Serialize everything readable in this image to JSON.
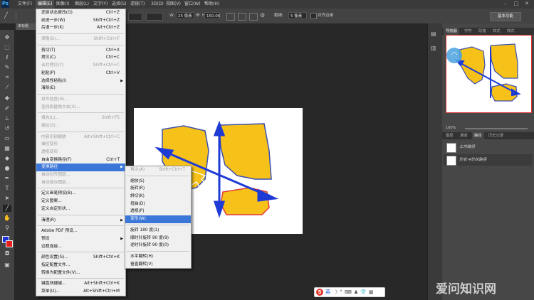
{
  "app": {
    "logo": "Ps"
  },
  "menubar": {
    "items": [
      "文件(F)",
      "编辑(E)",
      "图像(I)",
      "图层(L)",
      "文字(Y)",
      "选择(S)",
      "滤镜(T)",
      "3D(D)",
      "视图(V)",
      "窗口(W)",
      "帮助(H)"
    ],
    "active": "编辑(E)"
  },
  "options": {
    "w_label": "W:",
    "w_value": "25 像素",
    "h_value": "150.06",
    "radius_label": "粗细:",
    "radius_value": "5 像素",
    "align_label": "对齐边缘",
    "workspace": "基本功能"
  },
  "document": {
    "tab_title": "未标题"
  },
  "edit_menu": {
    "items": [
      {
        "label": "还原状态更改(O)",
        "shortcut": "Ctrl+Z"
      },
      {
        "label": "前进一步(W)",
        "shortcut": "Shift+Ctrl+Z"
      },
      {
        "label": "后退一步(K)",
        "shortcut": "Alt+Ctrl+Z"
      },
      {
        "sep": true
      },
      {
        "label": "渐隐(D)...",
        "shortcut": "Shift+Ctrl+F",
        "disabled": true
      },
      {
        "sep": true
      },
      {
        "label": "剪切(T)",
        "shortcut": "Ctrl+X"
      },
      {
        "label": "拷贝(C)",
        "shortcut": "Ctrl+C"
      },
      {
        "label": "合并拷贝(Y)",
        "shortcut": "Shift+Ctrl+C",
        "disabled": true
      },
      {
        "label": "粘贴(P)",
        "shortcut": "Ctrl+V"
      },
      {
        "label": "选择性粘贴(I)",
        "submenu": true
      },
      {
        "label": "清除(E)"
      },
      {
        "sep": true
      },
      {
        "label": "拼写检查(H)...",
        "disabled": true
      },
      {
        "label": "查找和替换文本(X)...",
        "disabled": true
      },
      {
        "sep": true
      },
      {
        "label": "填充(L)...",
        "shortcut": "Shift+F5",
        "disabled": true
      },
      {
        "label": "描边(S)...",
        "disabled": true
      },
      {
        "sep": true
      },
      {
        "label": "内容识别缩放",
        "shortcut": "Alt+Shift+Ctrl+C",
        "disabled": true
      },
      {
        "label": "操控变形",
        "disabled": true
      },
      {
        "label": "透视变形",
        "disabled": true
      },
      {
        "label": "自由变换路径(F)",
        "shortcut": "Ctrl+T"
      },
      {
        "label": "变换路径",
        "submenu": true,
        "highlight": true
      },
      {
        "label": "自动对齐图层...",
        "disabled": true
      },
      {
        "label": "自动混合图层...",
        "disabled": true
      },
      {
        "sep": true
      },
      {
        "label": "定义画笔预设(B)..."
      },
      {
        "label": "定义图案..."
      },
      {
        "label": "定义自定形状..."
      },
      {
        "sep": true
      },
      {
        "label": "清理(R)",
        "submenu": true
      },
      {
        "sep": true
      },
      {
        "label": "Adobe PDF 预设..."
      },
      {
        "label": "预设",
        "submenu": true
      },
      {
        "label": "远程连接..."
      },
      {
        "sep": true
      },
      {
        "label": "颜色设置(G)...",
        "shortcut": "Shift+Ctrl+K"
      },
      {
        "label": "指定配置文件..."
      },
      {
        "label": "转换为配置文件(V)..."
      },
      {
        "sep": true
      },
      {
        "label": "键盘快捷键...",
        "shortcut": "Alt+Shift+Ctrl+K"
      },
      {
        "label": "菜单(U)...",
        "shortcut": "Alt+Shift+Ctrl+M"
      }
    ]
  },
  "transform_menu": {
    "items": [
      {
        "label": "再次(A)",
        "shortcut": "Shift+Ctrl+T",
        "disabled": true
      },
      {
        "sep": true
      },
      {
        "label": "缩放(S)"
      },
      {
        "label": "旋转(R)"
      },
      {
        "label": "斜切(K)"
      },
      {
        "label": "扭曲(D)"
      },
      {
        "label": "透视(P)"
      },
      {
        "label": "变形(W)",
        "highlight": true
      },
      {
        "sep": true
      },
      {
        "label": "旋转 180 度(1)"
      },
      {
        "label": "顺时针旋转 90 度(9)"
      },
      {
        "label": "逆时针旋转 90 度(0)"
      },
      {
        "sep": true
      },
      {
        "label": "水平翻转(H)"
      },
      {
        "label": "垂直翻转(V)"
      }
    ]
  },
  "navigator": {
    "tabs": [
      "导航器",
      "字符",
      "段落",
      "样式",
      "样式"
    ],
    "zoom": "100%"
  },
  "paths_panel": {
    "tabs": [
      "图层",
      "通道",
      "路径",
      "历史记录"
    ],
    "items": [
      {
        "label": "工作路径"
      },
      {
        "label": "形状 4形状路径"
      }
    ]
  },
  "ime": {
    "label": "英"
  },
  "watermark": {
    "text": "爱问知识网"
  }
}
